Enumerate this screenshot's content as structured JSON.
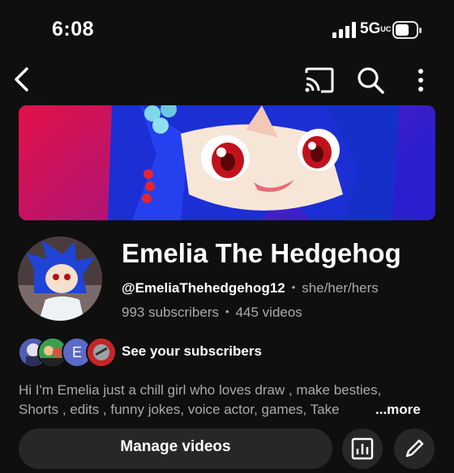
{
  "status_bar": {
    "time": "6:08",
    "network": "5G",
    "network_suffix": "UC",
    "icons": [
      "signal-icon",
      "battery-icon"
    ]
  },
  "nav": {
    "icons": [
      "back-arrow-icon",
      "cast-icon",
      "search-icon",
      "more-vert-icon"
    ]
  },
  "channel": {
    "name": "Emelia The Hedgehog",
    "handle": "@EmeliaThehedgehog12",
    "pronouns": "she/her/hers",
    "subscribers": "993 subscribers",
    "videos": "445 videos"
  },
  "subscribers_row": {
    "label": "See your subscribers",
    "avatar_letter": "E"
  },
  "description": {
    "line1": "Hi I'm Emelia  just a chill girl who loves draw , make besties,",
    "line2": "Shorts , edits , funny jokes,  voice actor, games, Take",
    "line2_fade": "",
    "more": "...more"
  },
  "actions": {
    "manage_videos": "Manage videos",
    "icons": [
      "analytics-icon",
      "edit-pencil-icon"
    ]
  },
  "colors": {
    "background": "#0f0f0f",
    "button_bg": "#272727",
    "secondary_text": "#aaaaaa"
  }
}
